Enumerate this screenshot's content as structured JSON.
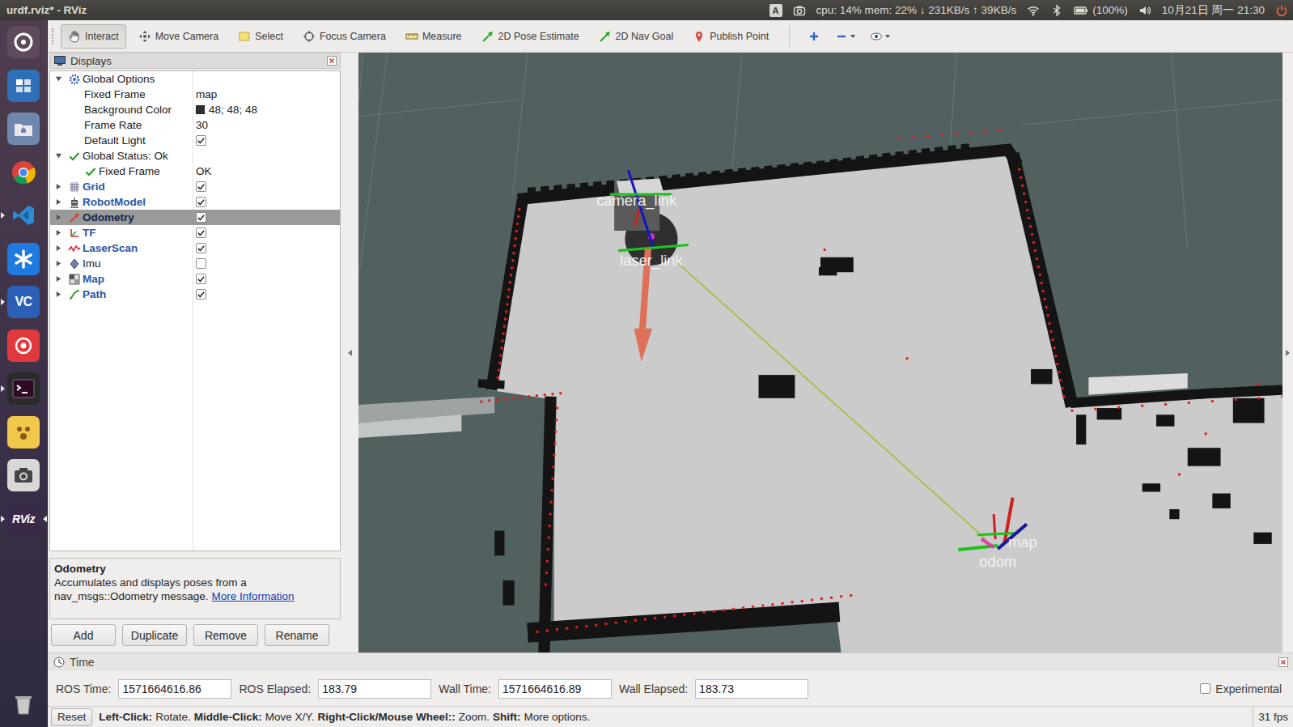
{
  "window": {
    "title": "urdf.rviz* - RViz"
  },
  "top_bar": {
    "keyboard": "A",
    "system_monitor": "cpu: 14% mem: 22% ↓ 231KB/s ↑ 39KB/s",
    "battery": "(100%)",
    "clock": "10月21日 周一 21:30"
  },
  "launcher": [
    {
      "kind": "dash",
      "selected": false,
      "running": false
    },
    {
      "kind": "workspaces",
      "selected": false,
      "running": false
    },
    {
      "kind": "files",
      "selected": false,
      "running": false
    },
    {
      "kind": "chrome",
      "selected": false,
      "running": false
    },
    {
      "kind": "vscode",
      "selected": false,
      "running": true
    },
    {
      "kind": "app",
      "selected": false,
      "running": false
    },
    {
      "kind": "vc",
      "text": "VC",
      "selected": false,
      "running": true
    },
    {
      "kind": "music",
      "selected": false,
      "running": false
    },
    {
      "kind": "terminal",
      "selected": false,
      "running": true
    },
    {
      "kind": "pet",
      "selected": false,
      "running": false
    },
    {
      "kind": "camera",
      "selected": false,
      "running": false
    },
    {
      "kind": "rviz",
      "text": "RViz",
      "selected": true,
      "running": true
    },
    {
      "kind": "trash",
      "selected": false,
      "running": false
    }
  ],
  "toolbar": {
    "tools": [
      {
        "label": "Interact",
        "selected": true
      },
      {
        "label": "Move Camera",
        "selected": false
      },
      {
        "label": "Select",
        "selected": false
      },
      {
        "label": "Focus Camera",
        "selected": false
      },
      {
        "label": "Measure",
        "selected": false
      },
      {
        "label": "2D Pose Estimate",
        "selected": false
      },
      {
        "label": "2D Nav Goal",
        "selected": false
      },
      {
        "label": "Publish Point",
        "selected": false
      }
    ]
  },
  "displays": {
    "title": "Displays",
    "rows": [
      {
        "label": "Global Options",
        "kind": "group",
        "depth": 0,
        "expanded": true,
        "selected": false
      },
      {
        "label": "Fixed Frame",
        "kind": "property",
        "depth": 1,
        "value": "map",
        "selected": false
      },
      {
        "label": "Background Color",
        "kind": "color",
        "depth": 1,
        "value": "48; 48; 48",
        "color": "#303030",
        "selected": false
      },
      {
        "label": "Frame Rate",
        "kind": "property",
        "depth": 1,
        "value": "30",
        "selected": false
      },
      {
        "label": "Default Light",
        "kind": "toggle",
        "depth": 1,
        "checked": true,
        "selected": false
      },
      {
        "label": "Global Status: Ok",
        "kind": "status",
        "depth": 0,
        "expanded": true,
        "ok": true,
        "selected": false
      },
      {
        "label": "Fixed Frame",
        "kind": "status",
        "depth": 1,
        "ok": true,
        "value": "OK",
        "selected": false
      },
      {
        "label": "Grid",
        "kind": "display",
        "depth": 0,
        "expanded": false,
        "checked": true,
        "selected": false
      },
      {
        "label": "RobotModel",
        "kind": "display",
        "depth": 0,
        "expanded": false,
        "checked": true,
        "selected": false
      },
      {
        "label": "Odometry",
        "kind": "display",
        "depth": 0,
        "expanded": false,
        "checked": true,
        "selected": true
      },
      {
        "label": "TF",
        "kind": "display",
        "depth": 0,
        "expanded": false,
        "checked": true,
        "selected": false
      },
      {
        "label": "LaserScan",
        "kind": "display",
        "depth": 0,
        "expanded": false,
        "checked": true,
        "selected": false
      },
      {
        "label": "Imu",
        "kind": "display",
        "depth": 0,
        "expanded": false,
        "checked": false,
        "selected": false
      },
      {
        "label": "Map",
        "kind": "display",
        "depth": 0,
        "expanded": false,
        "checked": true,
        "selected": false
      },
      {
        "label": "Path",
        "kind": "display",
        "depth": 0,
        "expanded": false,
        "checked": true,
        "selected": false
      }
    ],
    "description": {
      "title": "Odometry",
      "text": "Accumulates and displays poses from a nav_msgs::Odometry message.",
      "link": "More Information"
    },
    "buttons": [
      "Add",
      "Duplicate",
      "Remove",
      "Rename"
    ]
  },
  "view": {
    "frames": [
      {
        "label": "camera_link"
      },
      {
        "label": "laser_link"
      },
      {
        "label": "map"
      },
      {
        "label": "odom"
      }
    ]
  },
  "time": {
    "title": "Time",
    "fields": [
      {
        "label": "ROS Time:",
        "value": "1571664616.86"
      },
      {
        "label": "ROS Elapsed:",
        "value": "183.79"
      },
      {
        "label": "Wall Time:",
        "value": "1571664616.89"
      },
      {
        "label": "Wall Elapsed:",
        "value": "183.73"
      }
    ],
    "experimental": {
      "label": "Experimental",
      "checked": false
    }
  },
  "status_bar": {
    "reset": "Reset",
    "hints": [
      {
        "key": "Left-Click:",
        "action": "Rotate."
      },
      {
        "key": "Middle-Click:",
        "action": "Move X/Y."
      },
      {
        "key": "Right-Click/Mouse Wheel::",
        "action": "Zoom."
      },
      {
        "key": "Shift:",
        "action": "More options."
      }
    ],
    "fps": "31 fps"
  }
}
